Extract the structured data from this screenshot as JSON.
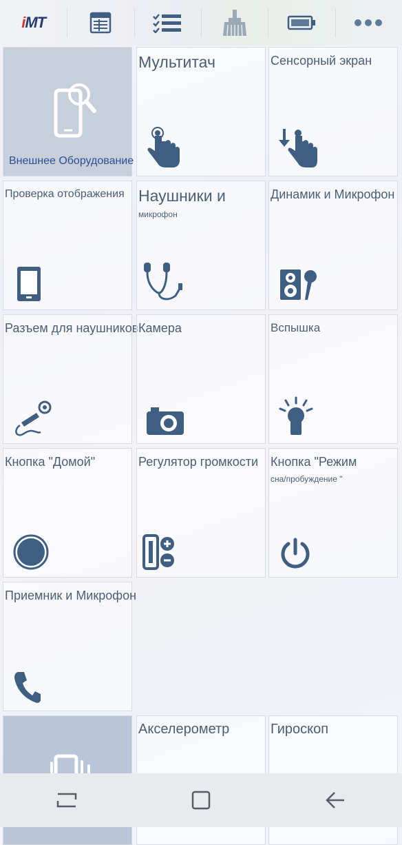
{
  "topbar": {
    "logo_text_main": "iMT",
    "items": [
      "logo",
      "report-icon",
      "checklist-icon",
      "cleaner-icon",
      "battery-icon",
      "more-icon"
    ]
  },
  "tiles": {
    "external": "Внешнее Оборудование",
    "multitouch": "Мультитач",
    "touchscreen": "Сенсорный экран",
    "display_check": "Проверка отображения",
    "headphones_main": "Наушники и",
    "headphones_sub": "микрофон",
    "speaker_mic": "Динамик и Микрофон",
    "jack": "Разъем для наушников",
    "camera": "Камера",
    "flash": "Вспышка",
    "home_button": "Кнопка \"Домой\"",
    "volume": "Регулятор громкости",
    "power_main": "Кнопка \"Режим",
    "power_sub": "сна/пробуждение \"",
    "receiver_mic": "Приемник и Микрофон",
    "accelerometer": "Акселерометр",
    "gyroscope": "Гироскоп"
  },
  "colors": {
    "icon": "#3e5e82",
    "title": "#4a5e75",
    "highlight": "#2c4f93"
  }
}
